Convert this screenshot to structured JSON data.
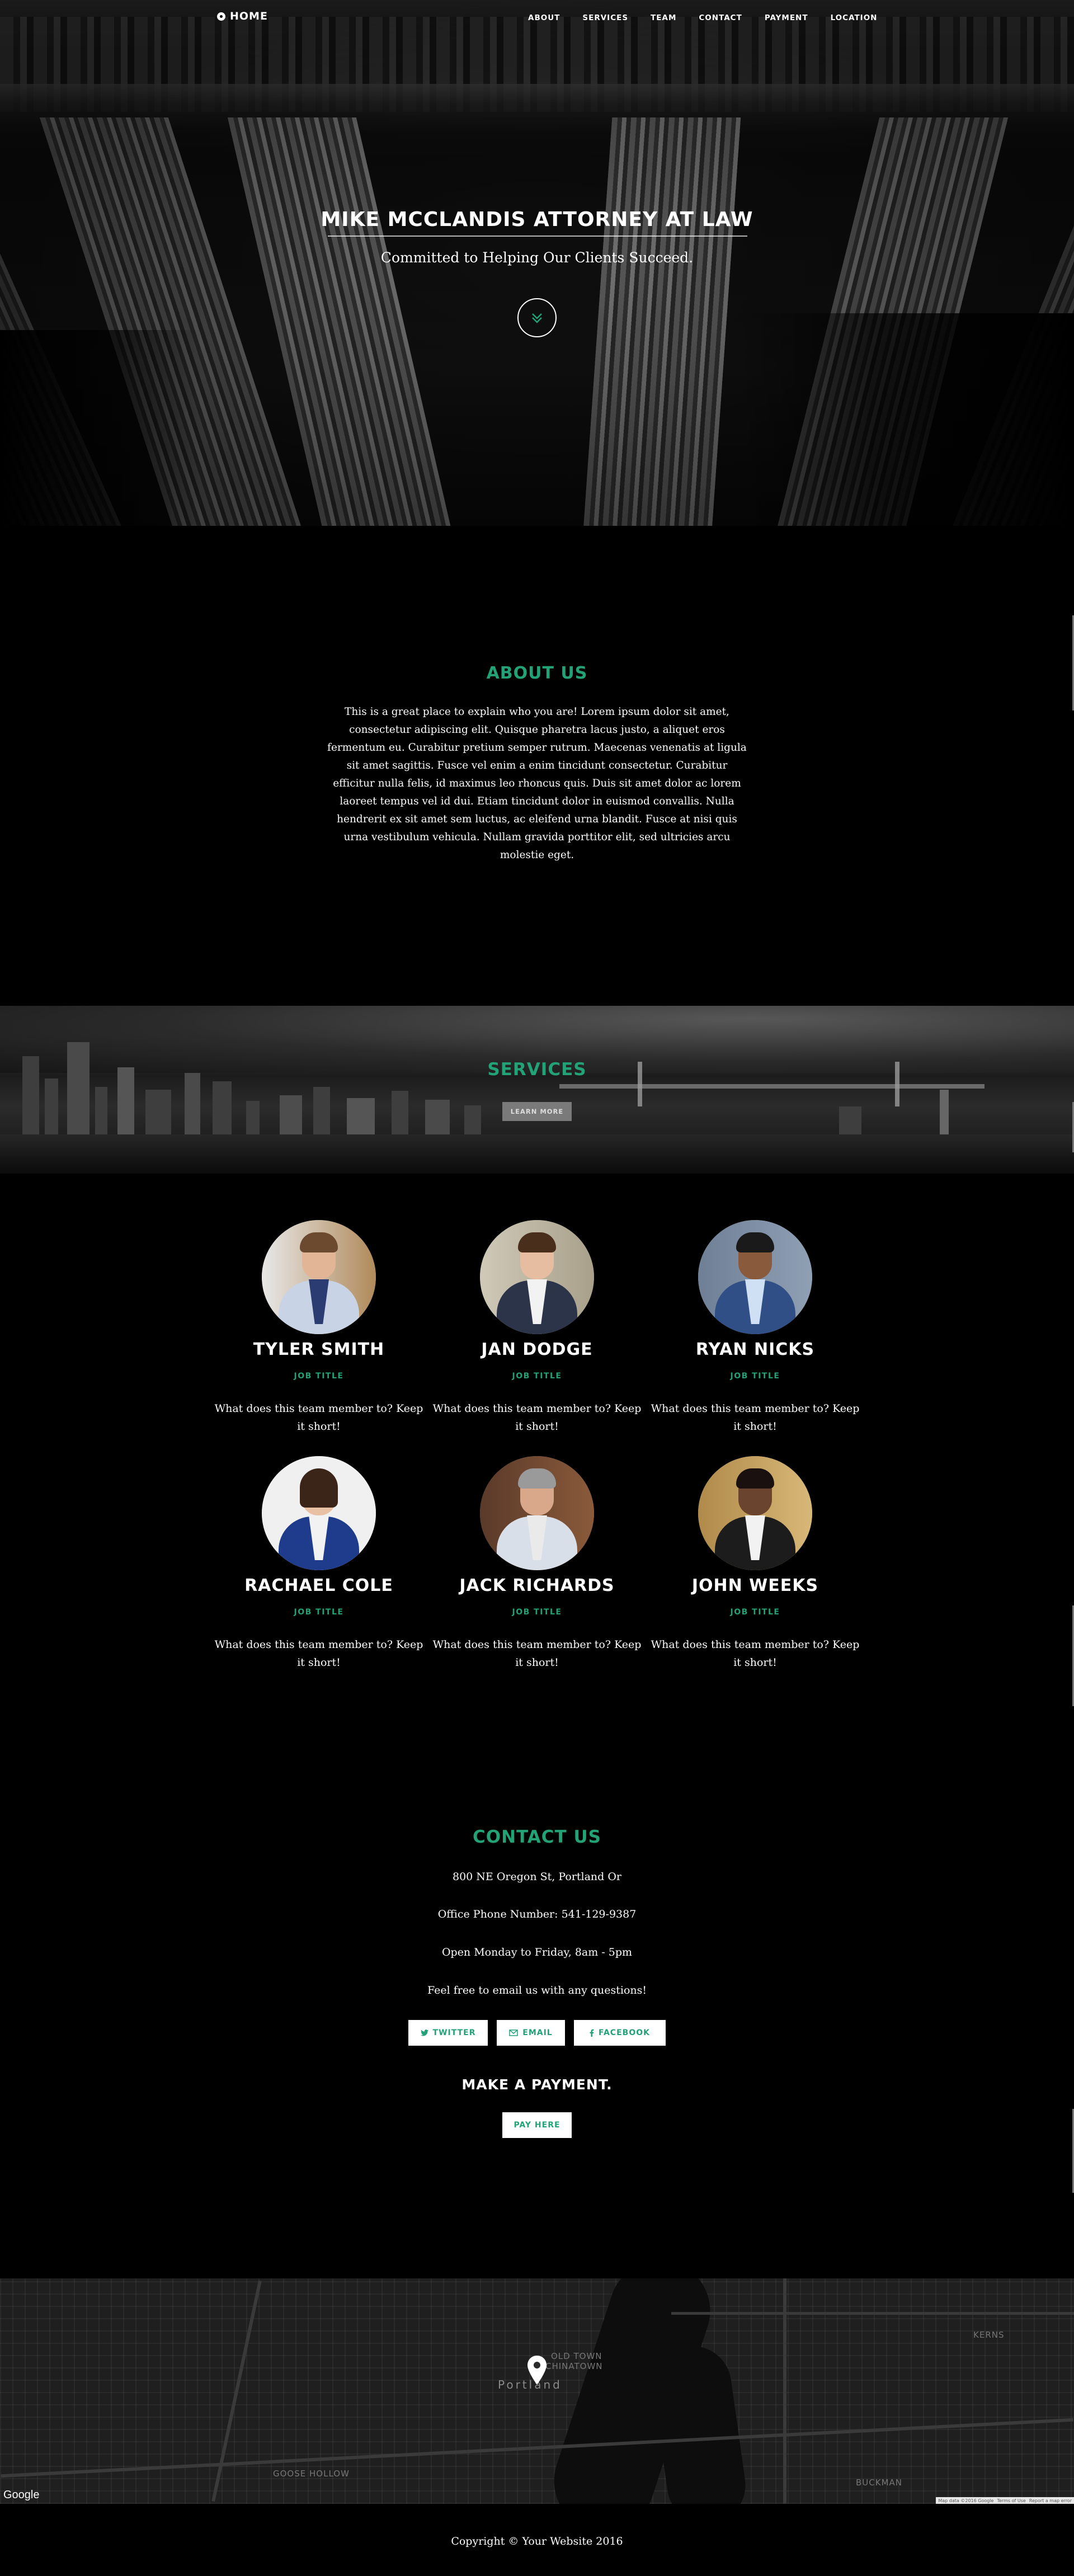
{
  "nav": {
    "brand": "HOME",
    "items": [
      "ABOUT",
      "SERVICES",
      "TEAM",
      "CONTACT",
      "PAYMENT",
      "LOCATION"
    ]
  },
  "hero": {
    "title": "MIKE MCCLANDIS ATTORNEY AT LAW",
    "subtitle": "Committed to Helping Our Clients Succeed."
  },
  "about": {
    "title": "ABOUT US",
    "text": "This is a great place to explain who you are! Lorem ipsum dolor sit amet, consectetur adipiscing elit. Quisque pharetra lacus justo, a aliquet eros fermentum eu. Curabitur pretium semper rutrum. Maecenas venenatis at ligula sit amet sagittis. Fusce vel enim a enim tincidunt consectetur. Curabitur efficitur nulla felis, id maximus leo rhoncus quis. Duis sit amet dolor ac lorem laoreet tempus vel id dui. Etiam tincidunt dolor in euismod convallis. Nulla hendrerit ex sit amet sem luctus, ac eleifend urna blandit. Fusce at nisi quis urna vestibulum vehicula. Nullam gravida porttitor elit, sed ultricies arcu molestie eget."
  },
  "services": {
    "title": "SERVICES",
    "button": "LEARN MORE"
  },
  "team": {
    "members": [
      {
        "name": "TYLER SMITH",
        "job": "JOB TITLE",
        "desc": "What does this team member to? Keep it short!"
      },
      {
        "name": "JAN DODGE",
        "job": "JOB TITLE",
        "desc": "What does this team member to? Keep it short!"
      },
      {
        "name": "RYAN NICKS",
        "job": "JOB TITLE",
        "desc": "What does this team member to? Keep it short!"
      },
      {
        "name": "RACHAEL COLE",
        "job": "JOB TITLE",
        "desc": "What does this team member to? Keep it short!"
      },
      {
        "name": "JACK RICHARDS",
        "job": "JOB TITLE",
        "desc": "What does this team member to? Keep it short!"
      },
      {
        "name": "JOHN WEEKS",
        "job": "JOB TITLE",
        "desc": "What does this team member to? Keep it short!"
      }
    ]
  },
  "contact": {
    "title": "CONTACT US",
    "address": "800 NE Oregon St, Portland Or",
    "phone": "Office Phone Number: 541-129-9387",
    "hours": "Open Monday to Friday, 8am - 5pm",
    "email_note": "Feel free to email us with any questions!",
    "social": [
      {
        "label": "TWITTER",
        "icon": "twitter-icon"
      },
      {
        "label": "EMAIL",
        "icon": "envelope-icon"
      },
      {
        "label": "FACEBOOK",
        "icon": "facebook-icon"
      }
    ]
  },
  "payment": {
    "title": "MAKE A PAYMENT.",
    "button": "PAY HERE"
  },
  "map": {
    "city": "Portland",
    "labels": {
      "old_town": "OLD TOWN",
      "chinatown": "CHINATOWN",
      "goose_hollow": "GOOSE HOLLOW",
      "buckman": "BUCKMAN",
      "kerns": "KERNS"
    },
    "provider": "Google",
    "attribution": [
      "Map data ©2016 Google",
      "Terms of Use",
      "Report a map error"
    ]
  },
  "footer": {
    "copyright": "Copyright © Your Website 2016"
  },
  "colors": {
    "accent": "#22a276",
    "background": "#000000",
    "text": "#ffffff"
  }
}
